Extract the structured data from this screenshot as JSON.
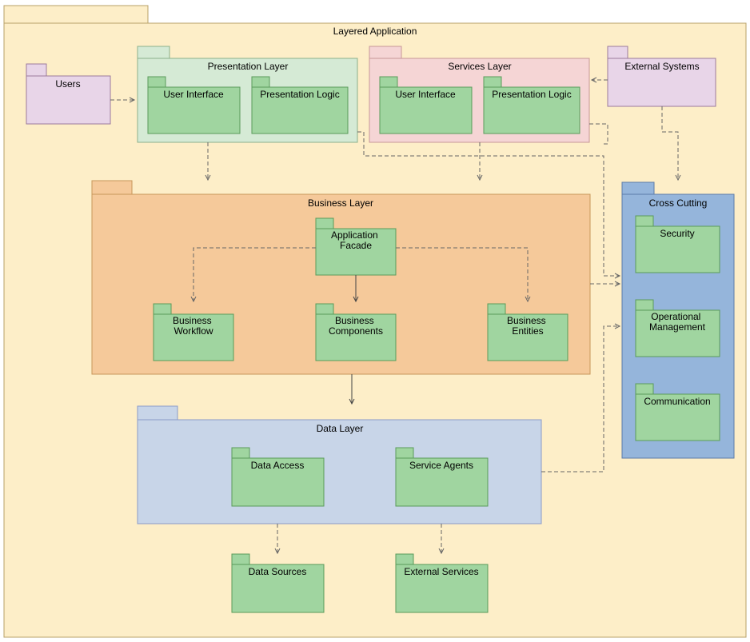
{
  "diagram": {
    "title": "Layered Application",
    "users": "Users",
    "externalSystems": "External Systems",
    "presentationLayer": {
      "title": "Presentation Layer",
      "userInterface": "User Interface",
      "presentationLogic": "Presentation Logic"
    },
    "servicesLayer": {
      "title": "Services Layer",
      "userInterface": "User Interface",
      "presentationLogic": "Presentation Logic"
    },
    "businessLayer": {
      "title": "Business Layer",
      "applicationFacade": "Application Facade",
      "businessWorkflow": "Business Workflow",
      "businessComponents": "Business Components",
      "businessEntities": "Business Entities"
    },
    "dataLayer": {
      "title": "Data Layer",
      "dataAccess": "Data Access",
      "serviceAgents": "Service Agents"
    },
    "dataSources": "Data Sources",
    "externalServices": "External Services",
    "crossCutting": {
      "title": "Cross Cutting",
      "security": "Security",
      "operationalManagement": "Operational Management",
      "communication": "Communication"
    }
  },
  "colors": {
    "cream": "#fdeec8",
    "creamStroke": "#b8a068",
    "purple": "#e8d5e8",
    "purpleStroke": "#9b7a9b",
    "mint": "#d5ead5",
    "mintStroke": "#8bb08b",
    "pink": "#f5d5d5",
    "pinkStroke": "#c89898",
    "green": "#a0d5a0",
    "greenStroke": "#5a9a5a",
    "orange": "#f5c99a",
    "orangeStroke": "#c8965a",
    "lightBlue": "#c8d5e8",
    "lightBlueStroke": "#8a9ac8",
    "blue": "#95b5db",
    "blueStroke": "#5a7aa8"
  }
}
